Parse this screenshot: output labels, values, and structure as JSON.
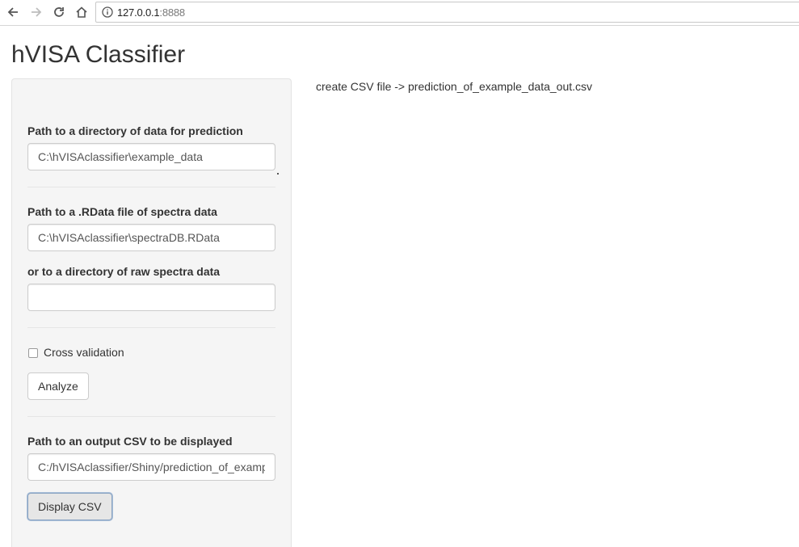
{
  "browser": {
    "url_host": "127.0.0.1",
    "url_port": ":8888"
  },
  "app": {
    "title": "hVISA Classifier"
  },
  "sidebar": {
    "data_dir": {
      "label": "Path to a directory of data for prediction",
      "value": "C:\\hVISAclassifier\\example_data"
    },
    "rdata_file": {
      "label": "Path to a .RData file of spectra data",
      "value": "C:\\hVISAclassifier\\spectraDB.RData"
    },
    "raw_dir": {
      "label": "or to a directory of raw spectra data",
      "value": ""
    },
    "cross_validation": {
      "label": "Cross validation",
      "checked": false
    },
    "analyze_button": "Analyze",
    "output_csv": {
      "label": "Path to an output CSV to be displayed",
      "value": "C:/hVISAclassifier/Shiny/prediction_of_example_data_out.csv"
    },
    "display_button": "Display CSV"
  },
  "main": {
    "status": "create CSV file -> prediction_of_example_data_out.csv"
  },
  "colors": {
    "sidebar_bg": "#f5f5f5",
    "text": "#333333",
    "input_border": "#cccccc"
  }
}
